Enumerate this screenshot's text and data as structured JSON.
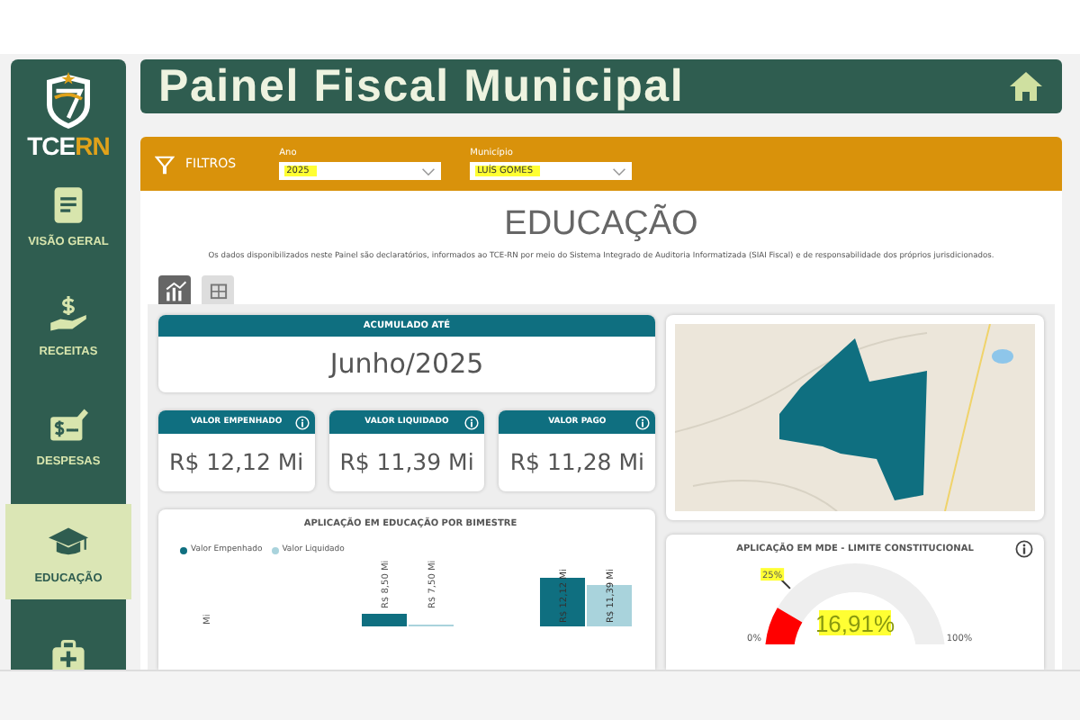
{
  "sidebar": {
    "logo": {
      "part_1": "TCE",
      "part_2": "RN"
    },
    "items": [
      {
        "kind": "document",
        "label": "VISÃO GERAL",
        "selected": false
      },
      {
        "kind": "money-hand",
        "label": "RECEITAS",
        "selected": false
      },
      {
        "kind": "check",
        "label": "DESPESAS",
        "selected": false
      },
      {
        "kind": "graduation",
        "label": "EDUCAÇÃO",
        "selected": true
      },
      {
        "kind": "medical",
        "selected": false
      }
    ]
  },
  "header": {
    "title": "Painel Fiscal Municipal"
  },
  "filters": {
    "label": "FILTROS",
    "fields": [
      {
        "label": "Ano",
        "value": "2025"
      },
      {
        "label": "Município",
        "value": "LUÍS GOMES"
      }
    ]
  },
  "page": {
    "title": "EDUCAÇÃO",
    "disclaimer": "Os dados disponibilizados neste Painel são declaratórios, informados ao TCE-RN por meio do Sistema Integrado de Auditoria Informatizada (SIAI Fiscal) e de responsabilidade dos próprios jurisdicionados."
  },
  "view_tabs": [
    {
      "kind": "chart",
      "selected": true
    },
    {
      "kind": "table",
      "selected": false
    }
  ],
  "accumulated": {
    "label": "ACUMULADO ATÉ",
    "value": "Junho/2025"
  },
  "kpis": [
    {
      "label": "VALOR EMPENHADO",
      "value": "R$ 12,12 Mi",
      "info": true
    },
    {
      "label": "VALOR LIQUIDADO",
      "value": "R$ 11,39 Mi",
      "info": true
    },
    {
      "label": "VALOR PAGO",
      "value": "R$ 11,28 Mi",
      "info": true
    }
  ],
  "bar_chart": {
    "title": "APLICAÇÃO EM EDUCAÇÃO POR BIMESTRE",
    "series": [
      {
        "name": "Valor Empenhado",
        "color": "#0f6f80",
        "value_labels": [
          "Mi",
          "R$ 8,50 Mi",
          "R$ 12,12 Mi"
        ]
      },
      {
        "name": "Valor Liquidado",
        "color": "#a9d3dc",
        "value_labels": [
          "R$ 7,50 Mi",
          "R$ 11,39 Mi"
        ]
      }
    ]
  },
  "gauge": {
    "title": "APLICAÇÃO EM MDE - LIMITE CONSTITUCIONAL",
    "level": 0.1691,
    "value": "16,91%",
    "target_label": "25%",
    "min_label": "0%",
    "max_label": "100%"
  }
}
